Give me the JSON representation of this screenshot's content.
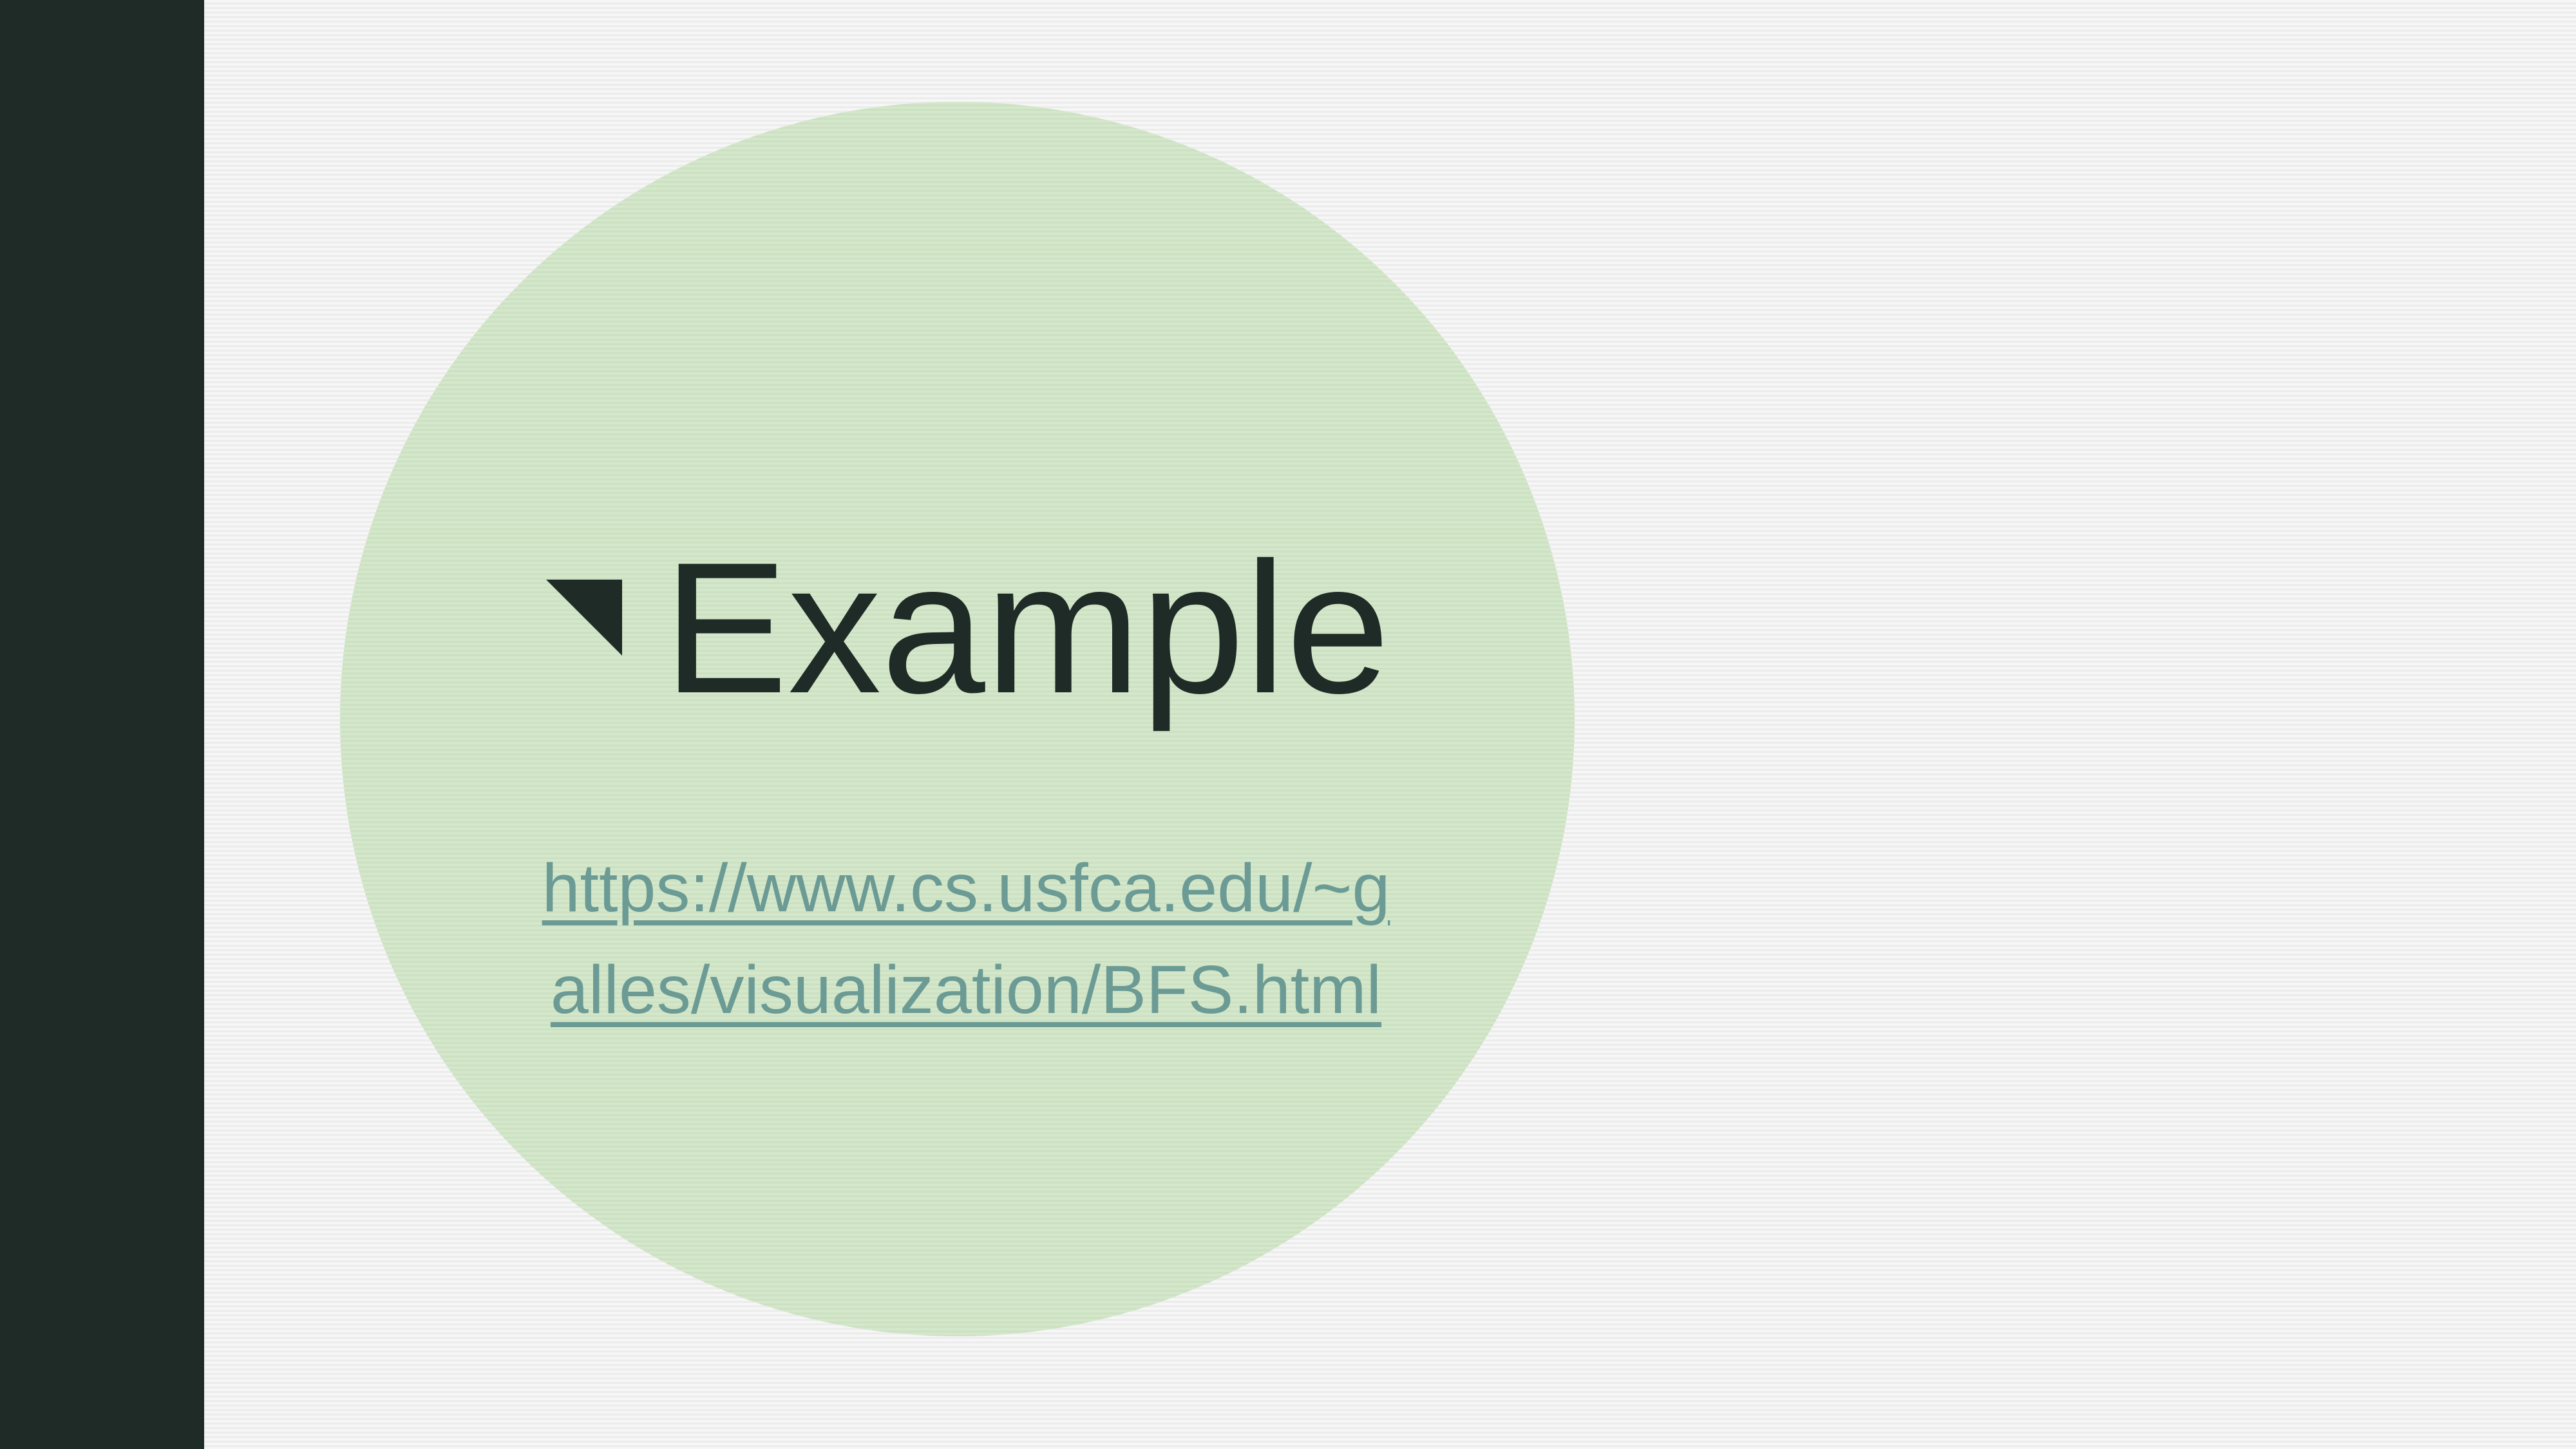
{
  "slide": {
    "title": "Example",
    "link": {
      "line1": "https://www.cs.usfca.edu/~g",
      "line2": "alles/visualization/BFS.html"
    }
  },
  "colors": {
    "sidebar": "#1e2b26",
    "circle": "#d1e5c8",
    "title": "#1e2b26",
    "link": "#6b9b94",
    "background": "#f3f3f3"
  },
  "icons": {
    "bullet": "triangle-bullet-icon"
  }
}
